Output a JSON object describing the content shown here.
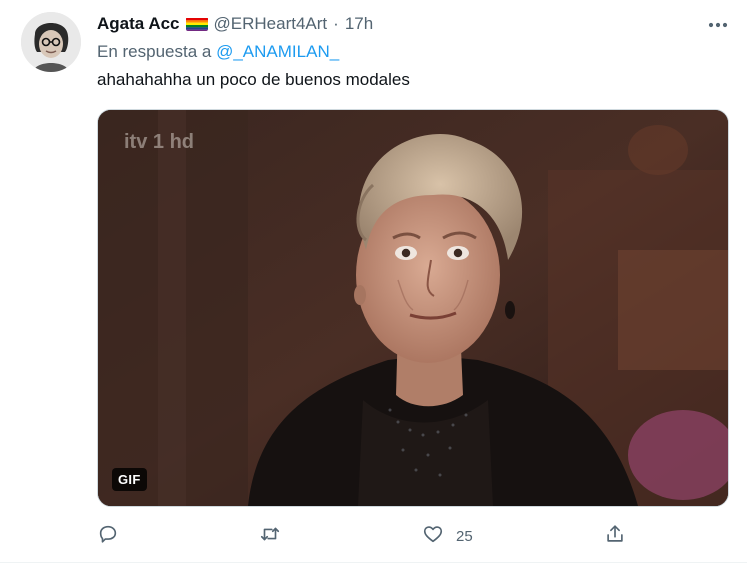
{
  "tweet": {
    "author": {
      "display_name": "Agata Acc",
      "handle": "@ERHeart4Art",
      "separator": "·",
      "time": "17h"
    },
    "reply_to": {
      "prefix": "En respuesta a",
      "mention": "@_ANAMILAN_"
    },
    "text": "ahahahahha un poco de buenos modales",
    "media": {
      "badge": "GIF",
      "watermark": "itv 1 hd"
    },
    "actions": {
      "reply_count": "",
      "retweet_count": "",
      "like_count": "25",
      "share_count": ""
    }
  },
  "colors": {
    "text": "#0f1419",
    "secondary": "#536471",
    "link": "#1d9bf0"
  },
  "icons": [
    "more-icon",
    "rainbow-flag-icon",
    "reply-icon",
    "retweet-icon",
    "like-icon",
    "share-icon"
  ]
}
